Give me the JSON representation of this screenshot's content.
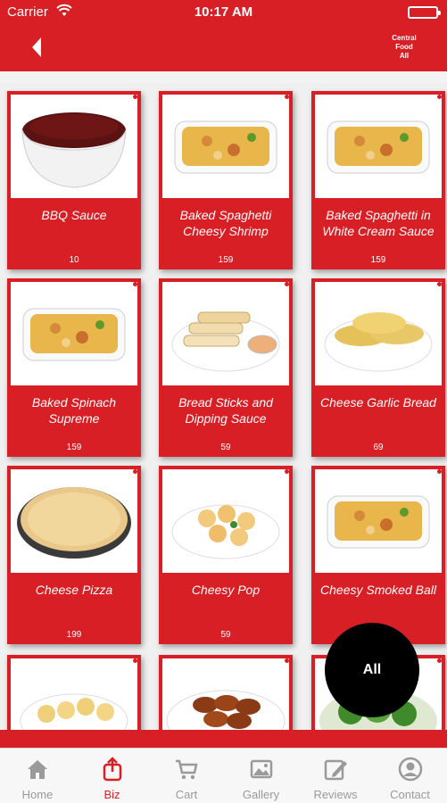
{
  "status": {
    "carrier": "Carrier",
    "time": "10:17 AM",
    "battery_level": 1.0
  },
  "nav": {
    "back_icon": "back-arrow-icon",
    "right_label_1": "Central",
    "right_label_2": "Food",
    "right_label_3": "All"
  },
  "items": [
    {
      "name": "BBQ Sauce",
      "price": "10",
      "image": "sauce-bowl"
    },
    {
      "name": "Baked Spaghetti Cheesy Shrimp",
      "price": "159",
      "image": "baked-dish"
    },
    {
      "name": "Baked Spaghetti in White Cream Sauce",
      "price": "159",
      "image": "baked-dish"
    },
    {
      "name": "Baked Spinach Supreme",
      "price": "159",
      "image": "baked-dish"
    },
    {
      "name": "Bread Sticks and Dipping Sauce",
      "price": "59",
      "image": "bread-sticks"
    },
    {
      "name": "Cheese Garlic Bread",
      "price": "69",
      "image": "garlic-bread"
    },
    {
      "name": "Cheese Pizza",
      "price": "199",
      "image": "pizza"
    },
    {
      "name": "Cheesy Pop",
      "price": "59",
      "image": "cheesy-pop"
    },
    {
      "name": "Cheesy Smoked Ball",
      "price": "",
      "image": "baked-dish"
    },
    {
      "name": "",
      "price": "",
      "image": "rolls"
    },
    {
      "name": "",
      "price": "",
      "image": "wings"
    },
    {
      "name": "",
      "price": "",
      "image": "salad"
    }
  ],
  "fab": {
    "label": "All"
  },
  "tabs": [
    {
      "label": "Home",
      "icon": "home-icon",
      "active": false
    },
    {
      "label": "Biz",
      "icon": "biz-icon",
      "active": true
    },
    {
      "label": "Cart",
      "icon": "cart-icon",
      "active": false
    },
    {
      "label": "Gallery",
      "icon": "gallery-icon",
      "active": false
    },
    {
      "label": "Reviews",
      "icon": "reviews-icon",
      "active": false
    },
    {
      "label": "Contact",
      "icon": "contact-icon",
      "active": false
    }
  ],
  "colors": {
    "brand_red": "#d81f26",
    "tab_inactive": "#9a9a9a",
    "battery_green": "#4cd964"
  }
}
